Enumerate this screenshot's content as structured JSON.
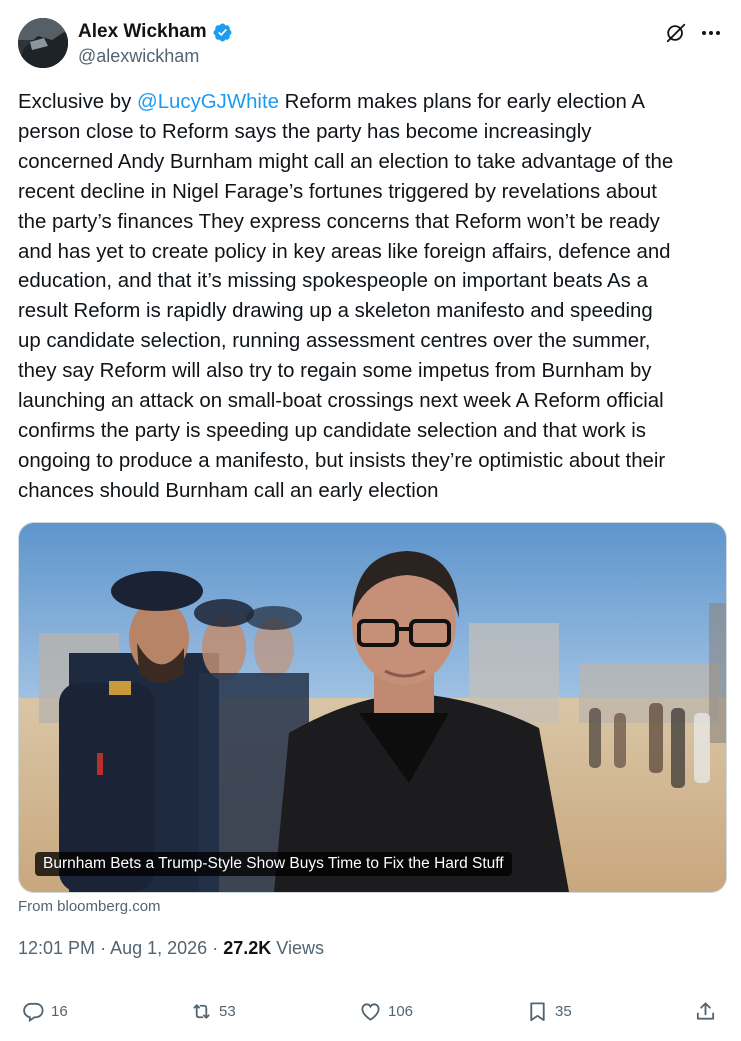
{
  "author": {
    "name": "Alex Wickham",
    "handle": "@alexwickham",
    "verified": true
  },
  "tweet": {
    "lines": [
      {
        "pre": "Exclusive by ",
        "mention": "@LucyGJWhite",
        "post": "  Reform makes plans for early election A"
      },
      {
        "text": "person close to Reform says the party has become increasingly"
      },
      {
        "text": "concerned Andy Burnham might call an election to take advantage of the"
      },
      {
        "text": "recent decline in Nigel Farage’s fortunes triggered by revelations about"
      },
      {
        "text": "the party’s finances  They express concerns that Reform won’t be ready"
      },
      {
        "text": "and has yet to create policy in key areas like foreign affairs, defence and"
      },
      {
        "text": "education, and that it’s missing spokespeople on important beats As a"
      },
      {
        "text": "result Reform is rapidly drawing up a skeleton manifesto and speeding"
      },
      {
        "text": "up candidate selection, running assessment centres over the summer,"
      },
      {
        "text": "they say Reform will also try to regain some impetus from Burnham by"
      },
      {
        "text": "launching an attack on small-boat crossings next week A Reform official"
      },
      {
        "text": "confirms the party is speeding up candidate selection and that work is"
      },
      {
        "text": "ongoing to produce a manifesto, but insists they’re optimistic about their"
      },
      {
        "text": "chances should Burnham call an early election"
      }
    ]
  },
  "card": {
    "caption": "Burnham Bets a Trump-Style Show Buys Time to Fix the Hard Stuff",
    "source": "From bloomberg.com"
  },
  "meta": {
    "time": "12:01 PM",
    "date": "Aug 1, 2026",
    "views_count": "27.2K",
    "views_label": "Views"
  },
  "actions": {
    "replies": "16",
    "reposts": "53",
    "likes": "106",
    "bookmarks": "35"
  },
  "colors": {
    "accent": "#1d9bf0",
    "text": "#0f1419",
    "secondary": "#536471"
  },
  "icons": [
    "verified-badge-icon",
    "grok-icon",
    "more-icon",
    "reply-icon",
    "repost-icon",
    "like-icon",
    "bookmark-icon",
    "share-icon"
  ]
}
